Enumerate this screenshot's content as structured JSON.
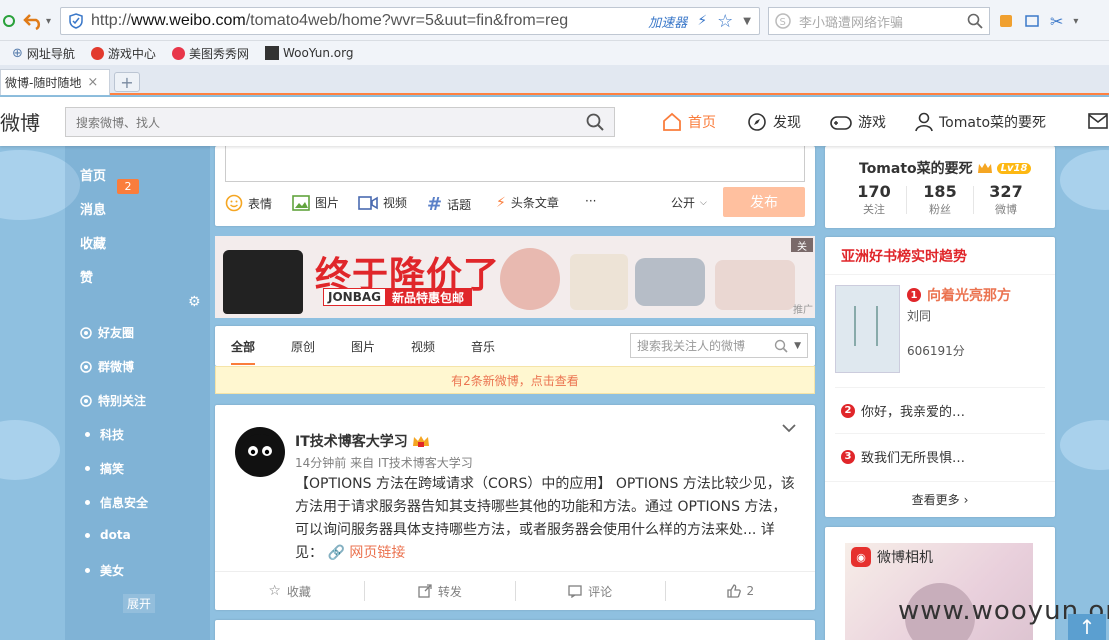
{
  "browser": {
    "url_prefix": "http://",
    "url_domain": "www.weibo.com",
    "url_path": "/tomato4web/home?wvr=5&uut=fin&from=reg",
    "accelerator": "加速器",
    "search_placeholder": "李小璐遭网络诈骗",
    "bookmarks": [
      "网址导航",
      "游戏中心",
      "美图秀秀网",
      "WooYun.org"
    ],
    "tab_title": "微博-随时随地",
    "tab_close": "×",
    "new_tab": "+"
  },
  "weibo_nav": {
    "logo": "微博",
    "search_placeholder": "搜索微博、找人",
    "links": [
      "首页",
      "发现",
      "游戏",
      "Tomato菜的要死"
    ]
  },
  "left_nav": {
    "main": [
      "首页",
      "消息",
      "收藏",
      "赞"
    ],
    "groups": [
      {
        "label": "好友圈",
        "count": "2"
      },
      {
        "label": "群微博"
      },
      {
        "label": "特别关注"
      }
    ],
    "subs": [
      "科技",
      "搞笑",
      "信息安全",
      "dota",
      "美女"
    ],
    "expand": "展开"
  },
  "composer": {
    "tools": [
      "表情",
      "图片",
      "视频",
      "话题",
      "头条文章",
      "···"
    ],
    "visibility": "公开",
    "publish": "发布"
  },
  "ad": {
    "title": "终于降价了",
    "brand": "JONBAG",
    "tag": "新品特惠包邮",
    "close": "关",
    "label": "推广"
  },
  "feed_tabs": [
    "全部",
    "原创",
    "图片",
    "视频",
    "音乐"
  ],
  "feed_search_placeholder": "搜索我关注人的微博",
  "new_posts_notice": "有2条新微博，点击查看",
  "post": {
    "author": "IT技术博客大学习",
    "meta": "14分钟前 来自 IT技术博客大学习",
    "text": "【OPTIONS 方法在跨域请求（CORS）中的应用】 OPTIONS 方法比较少见，该方法用于请求服务器告知其支持哪些其他的功能和方法。通过 OPTIONS 方法，可以询问服务器具体支持哪些方法，或者服务器会使用什么样的方法来处... 详见：",
    "link": "网页链接",
    "actions": [
      "收藏",
      "转发",
      "评论",
      "2"
    ]
  },
  "profile": {
    "name": "Tomato菜的要死",
    "level": "Lv18",
    "stats": [
      {
        "n": "170",
        "l": "关注"
      },
      {
        "n": "185",
        "l": "粉丝"
      },
      {
        "n": "327",
        "l": "微博"
      }
    ]
  },
  "books": {
    "header": "亚洲好书榜实时趋势",
    "items": [
      {
        "rank": "1",
        "title": "向着光亮那方",
        "author": "刘同",
        "score": "606191分"
      },
      {
        "rank": "2",
        "title": "你好，我亲爱的…"
      },
      {
        "rank": "3",
        "title": "致我们无所畏惧…"
      }
    ],
    "more": "查看更多"
  },
  "camera": {
    "label": "微博相机"
  },
  "watermark": "www.wooyun.org",
  "colors": {
    "accent": "#fa7d3c",
    "rank_red": "#e0262a",
    "link": "#eb7350"
  }
}
